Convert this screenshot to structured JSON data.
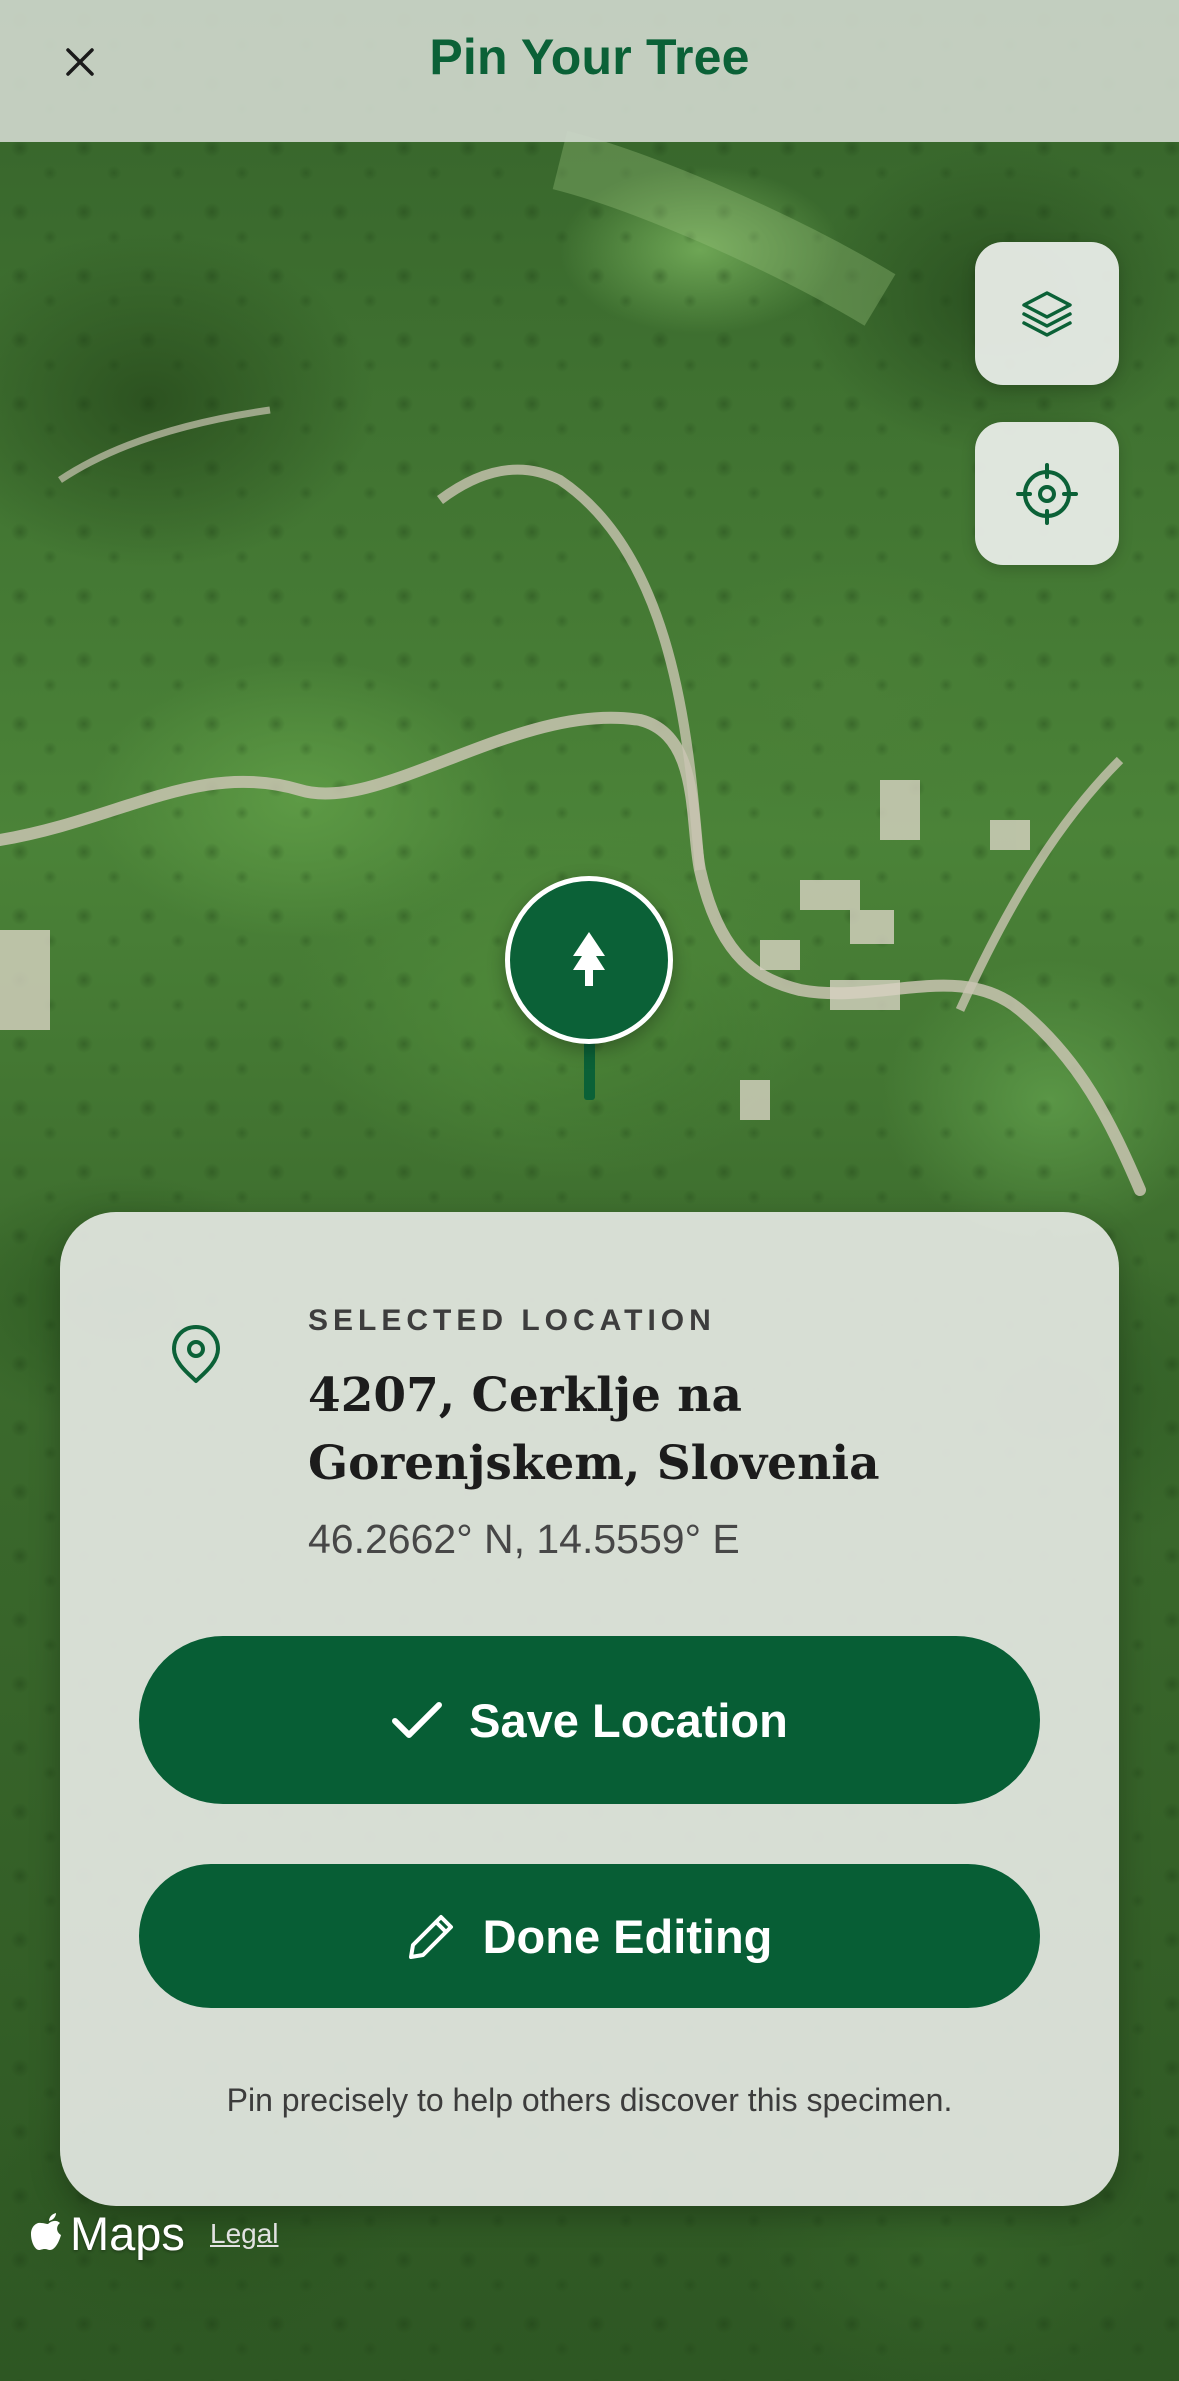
{
  "header": {
    "title": "Pin Your Tree",
    "close_icon": "close-icon"
  },
  "map": {
    "type": "satellite",
    "controls": [
      {
        "icon": "layers-icon"
      },
      {
        "icon": "crosshair-locate-icon"
      }
    ],
    "pin_icon": "tree-icon",
    "attribution": {
      "logo_text": "Maps",
      "legal_label": "Legal"
    }
  },
  "sheet": {
    "section_label": "SELECTED LOCATION",
    "address": "4207, Cerklje na Gorenjskem, Slovenia",
    "coordinates": "46.2662° N, 14.5559° E",
    "save_label": "Save Location",
    "done_label": "Done Editing",
    "hint": "Pin precisely to help others discover this specimen."
  },
  "colors": {
    "brand_green": "#0b6137",
    "button_green": "#075e35",
    "sheet_bg": "#e1e5df"
  }
}
